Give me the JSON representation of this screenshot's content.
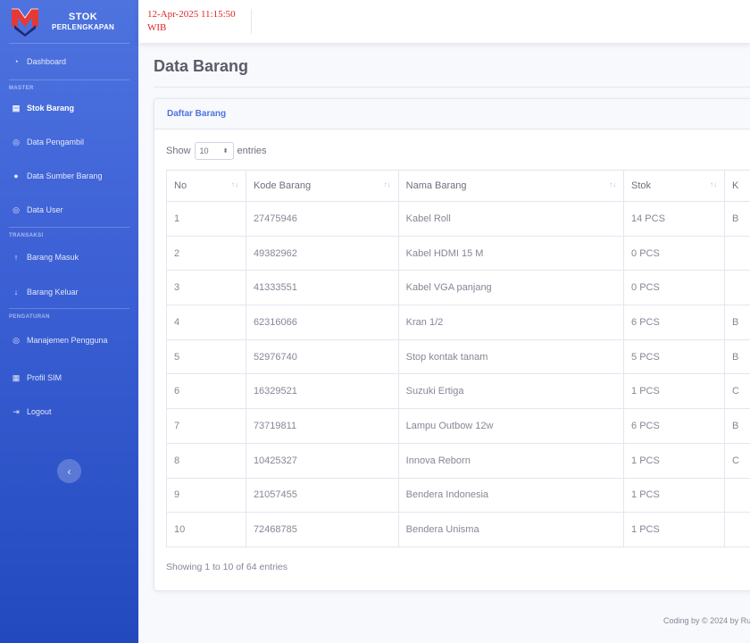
{
  "brand": {
    "line1": "STOK",
    "line2": "PERLENGKAPAN"
  },
  "clock": {
    "date": "12-Apr-2025 11:15:50",
    "zone": "WIB"
  },
  "sidebar": {
    "dashboard": "Dashboard",
    "section_master": "MASTER",
    "stok_barang": "Stok Barang",
    "data_pengambil": "Data Pengambil",
    "data_sumber": "Data Sumber Barang",
    "data_user": "Data User",
    "section_transaksi": "TRANSAKSI",
    "barang_masuk": "Barang Masuk",
    "barang_keluar": "Barang Keluar",
    "section_pengaturan": "PENGATURAN",
    "manajemen": "Manajemen Pengguna",
    "profil": "Profil SIM",
    "logout": "Logout",
    "toggle_icon": "‹"
  },
  "page": {
    "title": "Data Barang"
  },
  "card": {
    "header": "Daftar Barang"
  },
  "length": {
    "show": "Show",
    "value": "10",
    "entries": "entries"
  },
  "table": {
    "headers": {
      "no": "No",
      "kode": "Kode Barang",
      "nama": "Nama Barang",
      "stok": "Stok",
      "ket": "K"
    },
    "rows": [
      {
        "no": "1",
        "kode": "27475946",
        "nama": "Kabel Roll",
        "stok": "14 PCS",
        "ket": "B"
      },
      {
        "no": "2",
        "kode": "49382962",
        "nama": "Kabel HDMI 15 M",
        "stok": "0 PCS",
        "ket": ""
      },
      {
        "no": "3",
        "kode": "41333551",
        "nama": "Kabel VGA panjang",
        "stok": "0 PCS",
        "ket": ""
      },
      {
        "no": "4",
        "kode": "62316066",
        "nama": "Kran 1/2",
        "stok": "6 PCS",
        "ket": "B"
      },
      {
        "no": "5",
        "kode": "52976740",
        "nama": "Stop kontak tanam",
        "stok": "5 PCS",
        "ket": "B"
      },
      {
        "no": "6",
        "kode": "16329521",
        "nama": "Suzuki Ertiga",
        "stok": "1 PCS",
        "ket": "C"
      },
      {
        "no": "7",
        "kode": "73719811",
        "nama": "Lampu Outbow 12w",
        "stok": "6 PCS",
        "ket": "B"
      },
      {
        "no": "8",
        "kode": "10425327",
        "nama": "Innova Reborn",
        "stok": "1 PCS",
        "ket": "C"
      },
      {
        "no": "9",
        "kode": "21057455",
        "nama": "Bendera Indonesia",
        "stok": "1 PCS",
        "ket": ""
      },
      {
        "no": "10",
        "kode": "72468785",
        "nama": "Bendera Unisma",
        "stok": "1 PCS",
        "ket": ""
      }
    ]
  },
  "info": "Showing 1 to 10 of 64 entries",
  "footer": "Coding by © 2024 by Ru",
  "colors": {
    "sidebar_top": "#4e73df",
    "sidebar_bottom": "#224abe",
    "clock": "#e02424",
    "header_text": "#4e73df"
  }
}
